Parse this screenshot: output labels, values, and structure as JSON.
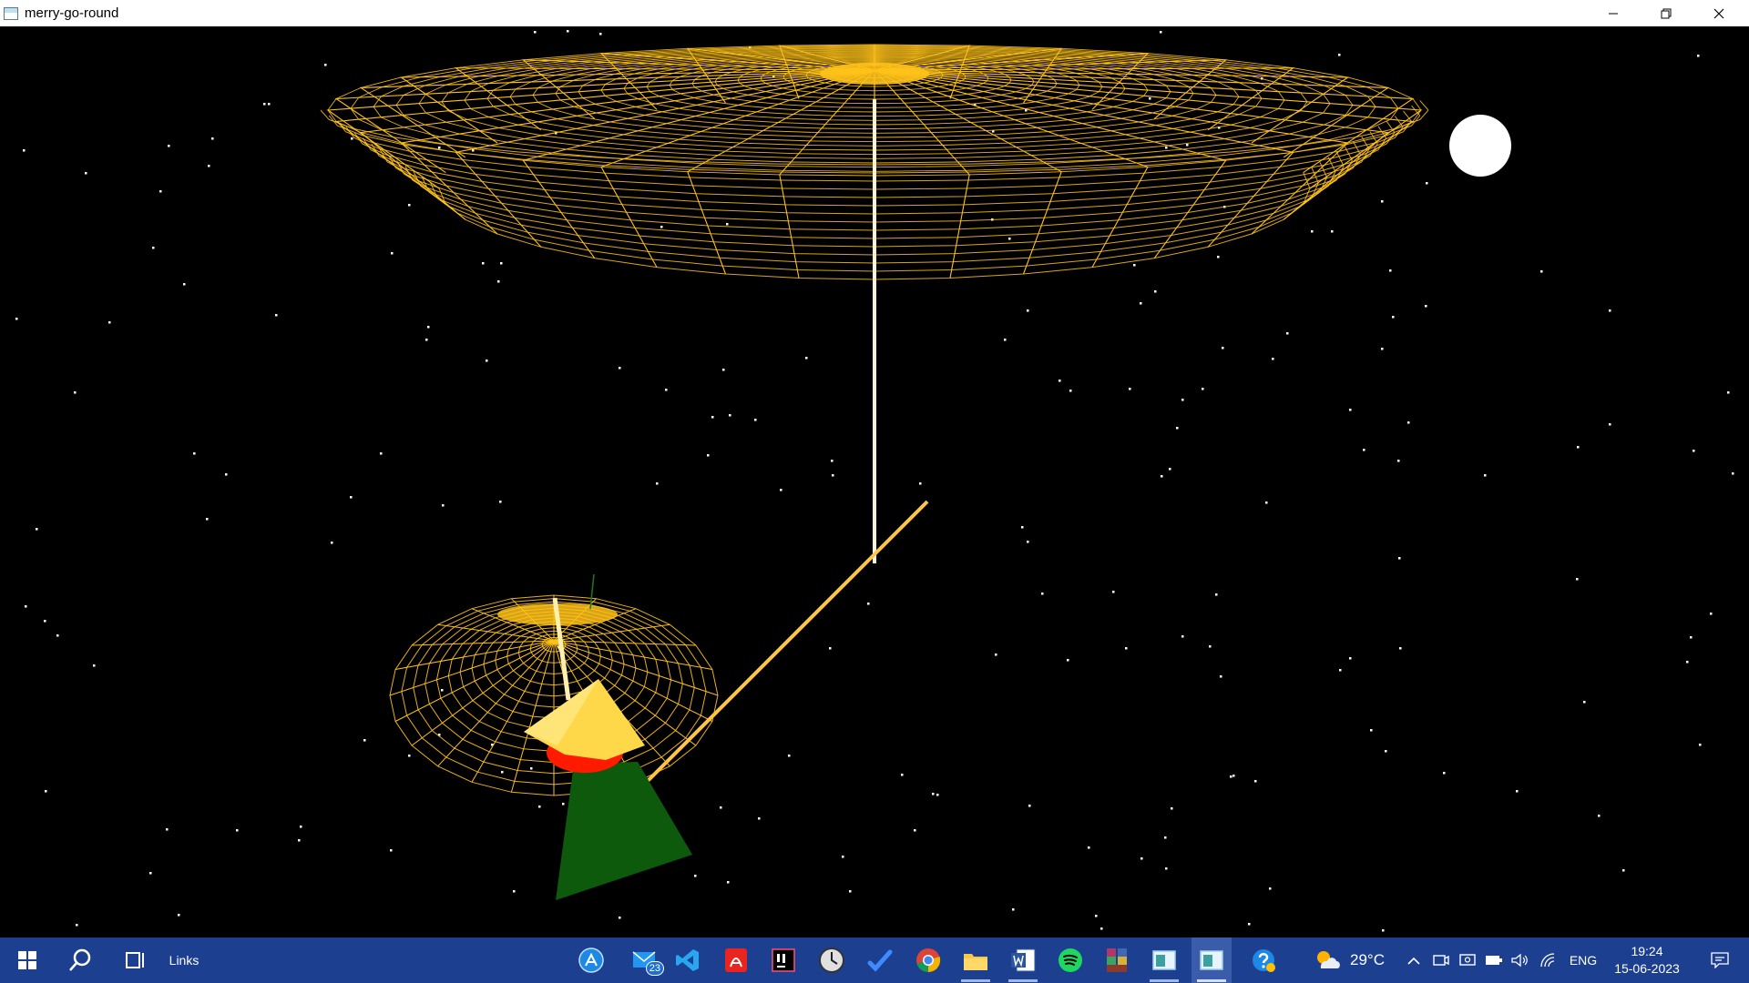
{
  "window": {
    "title": "merry-go-round"
  },
  "taskbar": {
    "toolbar_label": "Links",
    "weather": {
      "temperature": "29°C"
    },
    "tray": {
      "language": "ENG",
      "time": "19:24",
      "date": "15-06-2023"
    },
    "pinned": [
      {
        "name": "app-store-icon"
      },
      {
        "name": "mail-icon",
        "badge": "23"
      },
      {
        "name": "vscode-icon"
      },
      {
        "name": "acrobat-icon"
      },
      {
        "name": "intellij-icon"
      },
      {
        "name": "clock-icon"
      },
      {
        "name": "todo-icon"
      },
      {
        "name": "chrome-icon"
      },
      {
        "name": "file-explorer-icon"
      },
      {
        "name": "word-icon"
      },
      {
        "name": "spotify-icon"
      },
      {
        "name": "winrar-icon"
      },
      {
        "name": "opengl-window-icon"
      },
      {
        "name": "opengl-window-active-icon"
      },
      {
        "name": "help-icon"
      }
    ]
  },
  "scene": {
    "background": "#000000",
    "canopy_color": "#ffc21a",
    "pole_color": "#fff4d8",
    "arm_color": "#ffc54a",
    "moon_color": "#ffffff",
    "cone_green": "#0d5a0d",
    "cone_yellow": "#ffd84a",
    "ball_red": "#ff1a00"
  }
}
